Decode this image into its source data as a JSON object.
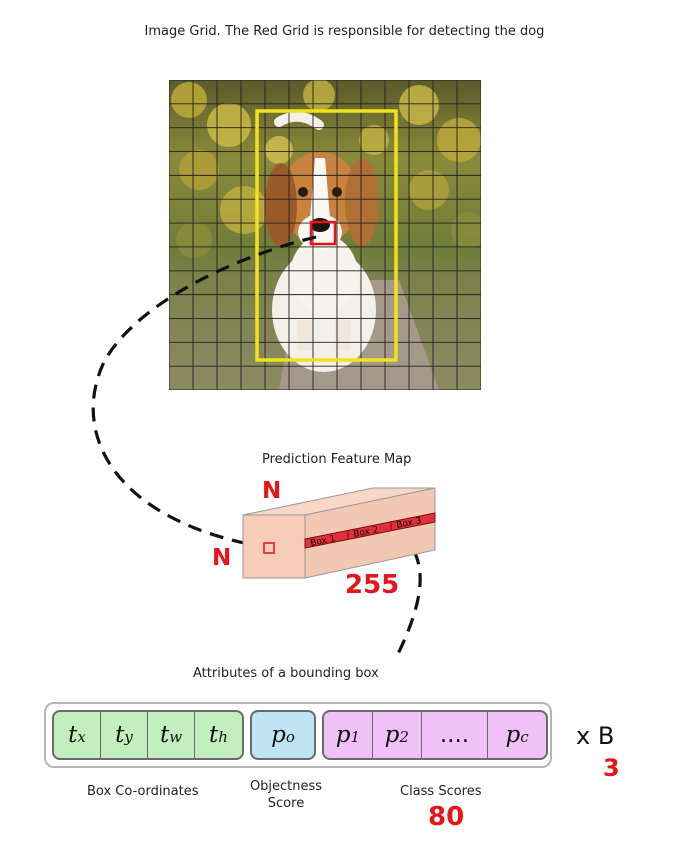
{
  "title": "Image Grid. The Red Grid is responsible for detecting the dog",
  "feature_map": {
    "title": "Prediction Feature Map",
    "n_top": "N",
    "n_left": "N",
    "depth": "255",
    "boxes": [
      "Box 1",
      "Box 2",
      "Box 3"
    ]
  },
  "attributes": {
    "title": "Attributes of a bounding box",
    "box_coords": [
      {
        "base": "t",
        "sub": "x"
      },
      {
        "base": "t",
        "sub": "y"
      },
      {
        "base": "t",
        "sub": "w"
      },
      {
        "base": "t",
        "sub": "h"
      }
    ],
    "objectness": {
      "base": "p",
      "sub": "o"
    },
    "class_scores": [
      {
        "base": "p",
        "sub": "1"
      },
      {
        "base": "p",
        "sub": "2"
      },
      {
        "base": "....",
        "sub": ""
      },
      {
        "base": "p",
        "sub": "c"
      }
    ],
    "times_b": "x B",
    "b_value": "3",
    "labels": {
      "box": "Box Co-ordinates",
      "objectness": "Objectness Score",
      "classes": "Class Scores"
    },
    "num_classes": "80"
  },
  "colors": {
    "accent_red": "#e8141a",
    "highlight_yellow": "#f2e21c",
    "box_green": "#c2efbd",
    "obj_blue": "#bfe4f3",
    "class_pink": "#efc1f6",
    "cuboid_peach": "#f6cdb8"
  }
}
